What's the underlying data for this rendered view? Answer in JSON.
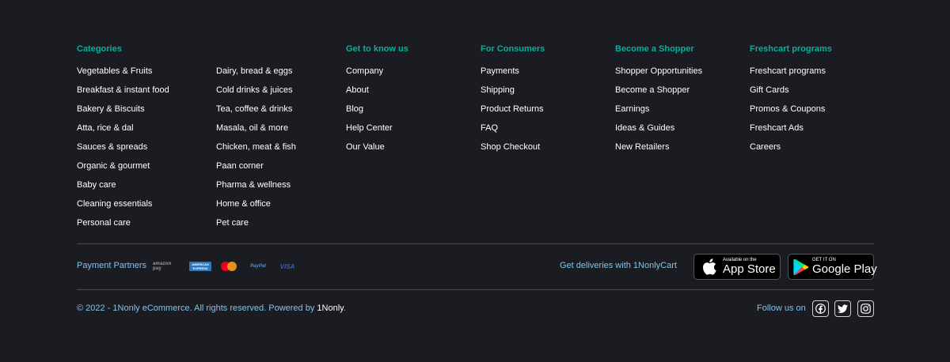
{
  "columns": {
    "categories": {
      "title": "Categories",
      "items_left": [
        "Vegetables & Fruits",
        "Breakfast & instant food",
        "Bakery & Biscuits",
        "Atta, rice & dal",
        "Sauces & spreads",
        "Organic & gourmet",
        "Baby care",
        "Cleaning essentials",
        "Personal care"
      ],
      "items_right": [
        "Dairy, bread & eggs",
        "Cold drinks & juices",
        "Tea, coffee & drinks",
        "Masala, oil & more",
        "Chicken, meat & fish",
        "Paan corner",
        "Pharma & wellness",
        "Home & office",
        "Pet care"
      ]
    },
    "get_to_know": {
      "title": "Get to know us",
      "items": [
        "Company",
        "About",
        "Blog",
        "Help Center",
        "Our Value"
      ]
    },
    "consumers": {
      "title": "For Consumers",
      "items": [
        "Payments",
        "Shipping",
        "Product Returns",
        "FAQ",
        "Shop Checkout"
      ]
    },
    "shopper": {
      "title": "Become a Shopper",
      "items": [
        "Shopper Opportunities",
        "Become a Shopper",
        "Earnings",
        "Ideas & Guides",
        "New Retailers"
      ]
    },
    "programs": {
      "title": "Freshcart programs",
      "items": [
        "Freshcart programs",
        "Gift Cards",
        "Promos & Coupons",
        "Freshcart Ads",
        "Careers"
      ]
    }
  },
  "payment": {
    "label": "Payment Partners",
    "partners": [
      "amazon-pay-logo",
      "american-express-logo",
      "mastercard-logo",
      "paypal-logo",
      "visa-logo"
    ],
    "amazon_text": "amazon pay",
    "amex_line1": "AMERICAN",
    "amex_line2": "EXPRESS",
    "paypal_text": "PayPal",
    "visa_text": "VISA"
  },
  "apps": {
    "deliveries_label": "Get deliveries with 1NonlyCart",
    "appstore_small": "Available on the",
    "appstore_big": "App Store",
    "googleplay_small": "GET IT ON",
    "googleplay_big": "Google Play"
  },
  "bottom": {
    "copyright_prefix": "© 2022 - 1Nonly eCommerce. All rights reserved. Powered by ",
    "copyright_brand": "1Nonly",
    "copyright_suffix": ".",
    "follow_label": "Follow us on",
    "socials": [
      "facebook-icon",
      "twitter-icon",
      "instagram-icon"
    ]
  },
  "colors": {
    "background": "#1b1c22",
    "heading": "#0aad9b",
    "link": "#ffffff",
    "muted": "#7fc4ee"
  }
}
